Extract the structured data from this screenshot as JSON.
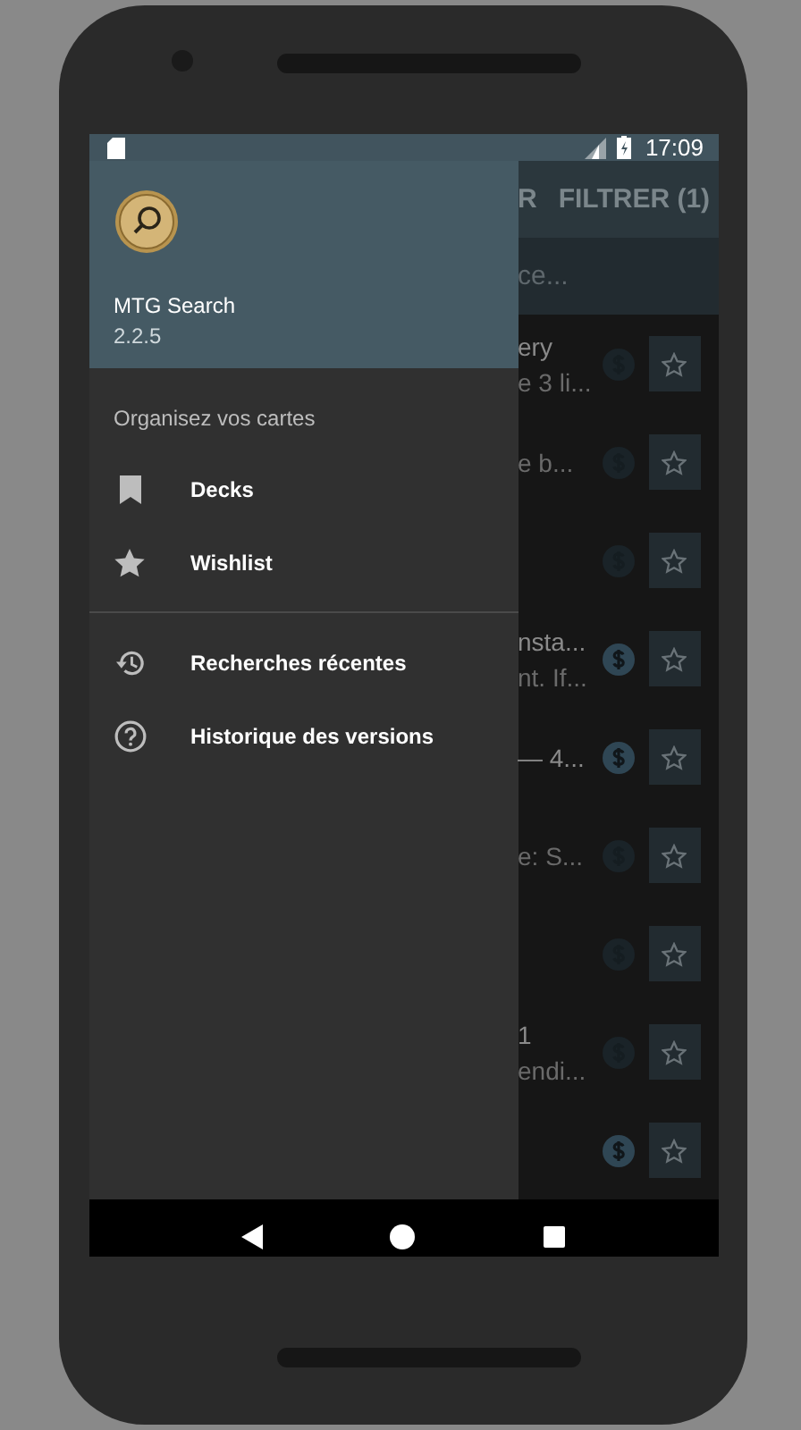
{
  "status_bar": {
    "time": "17:09"
  },
  "drawer": {
    "app_name": "MTG Search",
    "version": "2.2.5",
    "section_title": "Organisez vos cartes",
    "items": [
      {
        "kind": "bookmark",
        "label": "Decks"
      },
      {
        "kind": "star",
        "label": "Wishlist"
      },
      {
        "kind": "divider"
      },
      {
        "kind": "history",
        "label": "Recherches récentes"
      },
      {
        "kind": "help",
        "label": "Historique des versions"
      }
    ]
  },
  "toolbar": {
    "action_1": "R",
    "action_2": "FILTRER (1)"
  },
  "search": {
    "placeholder": "ce..."
  },
  "rows": [
    {
      "line_1": "ery",
      "line_2": "e 3 li...",
      "price_active": false
    },
    {
      "line_2": "e b...",
      "price_active": false
    },
    {
      "price_active": false
    },
    {
      "line_1": "nsta...",
      "line_2": "nt. If...",
      "price_active": true
    },
    {
      "line_1": "— 4...",
      "price_active": true
    },
    {
      "line_2": "e: S...",
      "price_active": false
    },
    {
      "price_active": false
    },
    {
      "line_1": "1",
      "line_2": "endi...",
      "price_active": false
    },
    {
      "price_active": true
    }
  ]
}
